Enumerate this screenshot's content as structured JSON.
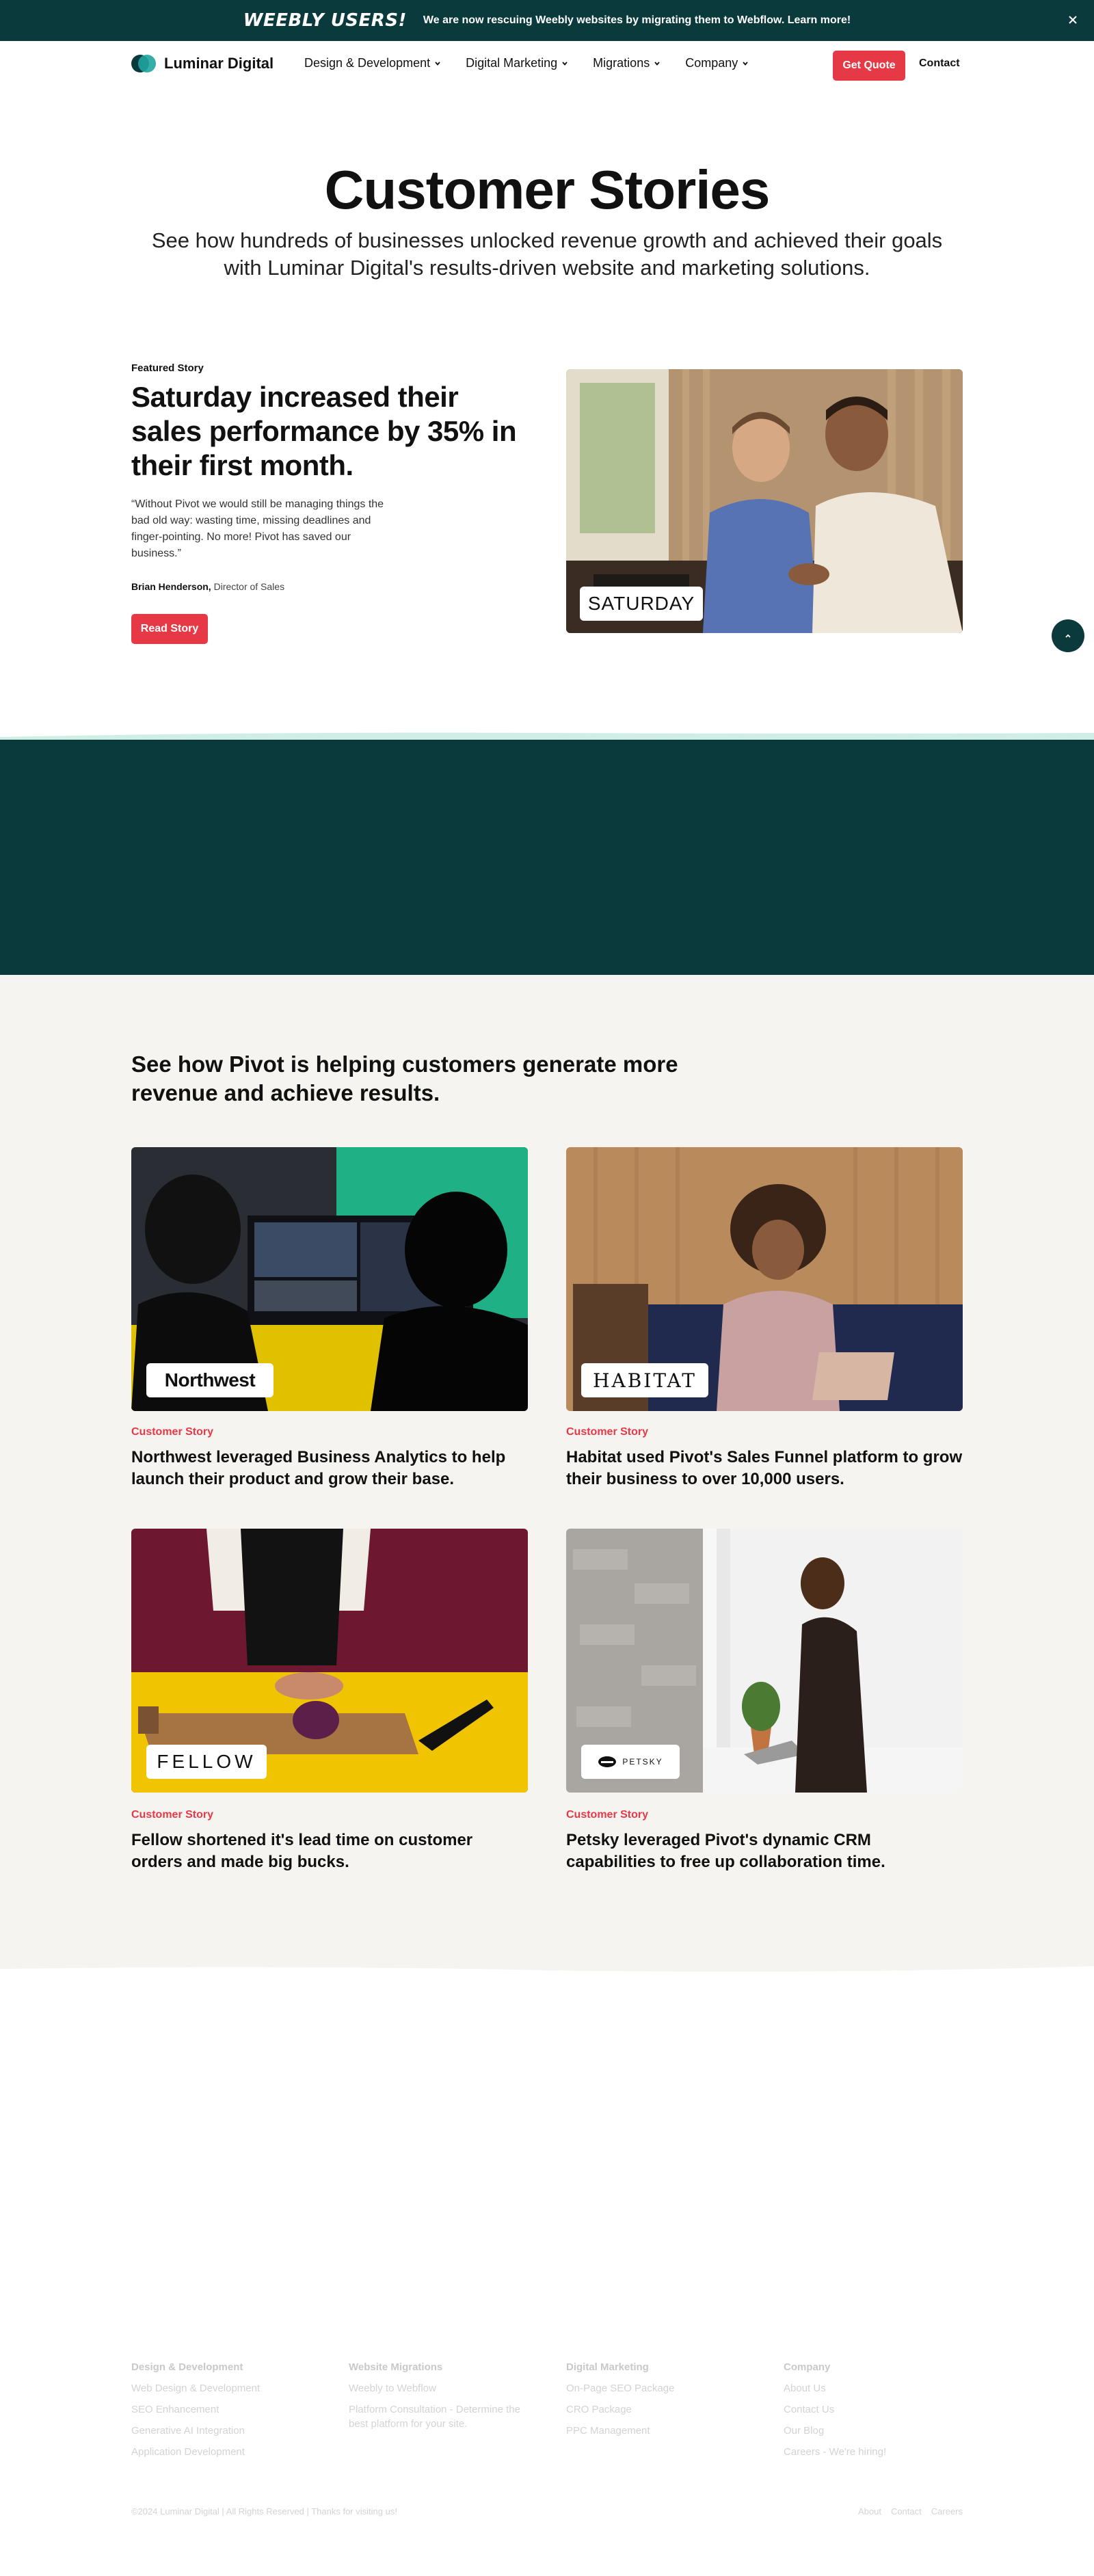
{
  "announcement": {
    "headline": "WEEBLY USERS!",
    "message": "We are now rescuing Weebly websites by migrating them to Webflow. Learn more!",
    "close_icon": "close-icon"
  },
  "header": {
    "logo_text": "Luminar Digital",
    "nav": [
      {
        "label": "Design & Development"
      },
      {
        "label": "Digital Marketing"
      },
      {
        "label": "Migrations"
      },
      {
        "label": "Company"
      }
    ],
    "cta_label": "Get Quote",
    "contact_label": "Contact"
  },
  "hero": {
    "title": "Customer Stories",
    "subtitle": "See how hundreds of businesses unlocked revenue growth and achieved their goals with Luminar Digital's results-driven website and marketing solutions."
  },
  "featured": {
    "label": "Featured Story",
    "title": "Saturday increased their sales performance by 35% in their first month.",
    "quote": "“Without Pivot we would still be managing things the bad old way: wasting time, missing deadlines and finger-pointing. No more! Pivot has saved our business.”",
    "author_name": "Brian Henderson,",
    "author_role": "Director of Sales",
    "button_label": "Read Story",
    "brand": "SATURDAY"
  },
  "stories": {
    "title": "See how Pivot is helping customers generate more revenue and achieve results.",
    "cards": [
      {
        "label": "Customer Story",
        "title": "Northwest leveraged Business Analytics to help launch their product and grow their base.",
        "brand": "Northwest"
      },
      {
        "label": "Customer Story",
        "title": "Habitat used Pivot's Sales Funnel platform to grow their business to over 10,000 users.",
        "brand": "HABITAT"
      },
      {
        "label": "Customer Story",
        "title": "Fellow shortened it's lead time on customer orders and made big bucks.",
        "brand": "FELLOW"
      },
      {
        "label": "Customer Story",
        "title": "Petsky leveraged Pivot's dynamic CRM capabilities to free up collaboration time.",
        "brand": "PETSKY"
      }
    ]
  },
  "footer": {
    "columns": [
      {
        "heading": "Design & Development",
        "links": [
          "Web Design & Development",
          "SEO Enhancement",
          "Generative AI Integration",
          "Application Development"
        ]
      },
      {
        "heading": "Website Migrations",
        "links": [
          "Weebly to Webflow",
          "Platform Consultation - Determine the best platform for your site."
        ]
      },
      {
        "heading": "Digital Marketing",
        "links": [
          "On-Page SEO Package",
          "CRO Package",
          "PPC Management"
        ]
      },
      {
        "heading": "Company",
        "links": [
          "About Us",
          "Contact Us",
          "Our Blog",
          "Careers - We're hiring!"
        ]
      }
    ],
    "copyright": "©2024 Luminar Digital | All Rights Reserved | Thanks for visiting us!",
    "bottom_links": [
      "About",
      "Contact",
      "Careers"
    ]
  },
  "colors": {
    "dark_teal": "#0b3a3c",
    "accent_red": "#e63946",
    "beige": "#f6f4f0"
  }
}
